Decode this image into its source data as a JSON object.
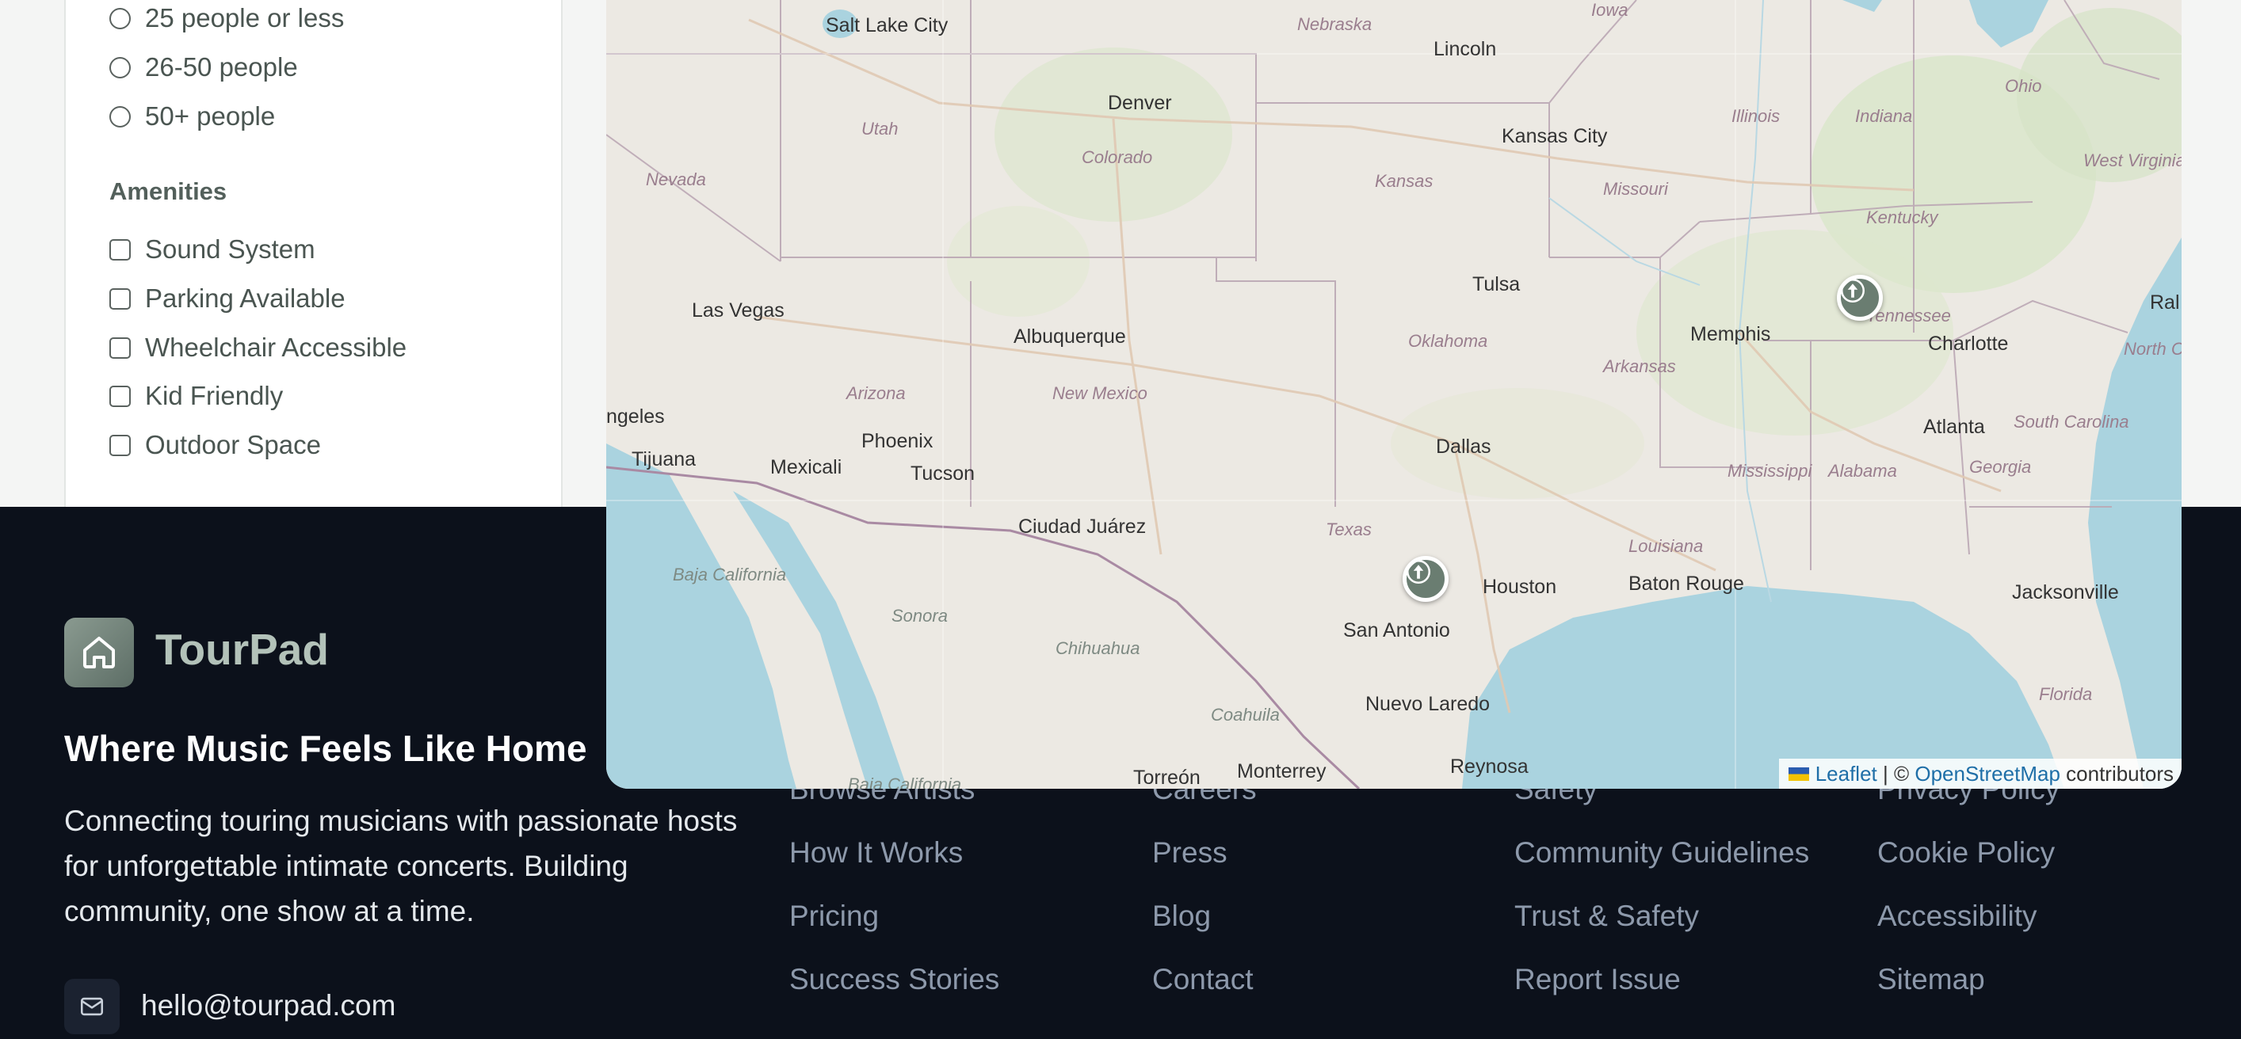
{
  "filters": {
    "capacity_options": [
      "25 people or less",
      "26-50 people",
      "50+ people"
    ],
    "amenities_title": "Amenities",
    "amenities": [
      "Sound System",
      "Parking Available",
      "Wheelchair Accessible",
      "Kid Friendly",
      "Outdoor Space"
    ]
  },
  "map": {
    "cities": [
      "Salt Lake City",
      "Denver",
      "Lincoln",
      "Kansas City",
      "Las Vegas",
      "Tulsa",
      "Albuquerque",
      "Memphis",
      "Charlotte",
      "Atlanta",
      "Dallas",
      "Phoenix",
      "Tucson",
      "Mexicali",
      "Tijuana",
      "Ciudad Juárez",
      "Houston",
      "San Antonio",
      "Baton Rouge",
      "Jacksonville",
      "Nuevo Laredo",
      "Monterrey",
      "Reynosa",
      "Torreón",
      "ngeles",
      "Ral"
    ],
    "states": [
      "Nebraska",
      "Iowa",
      "Utah",
      "Colorado",
      "Kansas",
      "Missouri",
      "Illinois",
      "Indiana",
      "Ohio",
      "West Virginia",
      "Kentucky",
      "Nevada",
      "Oklahoma",
      "Arkansas",
      "Tennessee",
      "North Ca",
      "Arizona",
      "New Mexico",
      "Mississippi",
      "Alabama",
      "Georgia",
      "South Carolina",
      "Texas",
      "Louisiana",
      "Florida",
      "Baja California",
      "Sonora",
      "Chihuahua",
      "Coahuila",
      "Baja California"
    ],
    "attribution": {
      "leaflet": "Leaflet",
      "separator": " | © ",
      "osm": "OpenStreetMap",
      "contributors": " contributors"
    },
    "marker_icon": "arrow-up-icon"
  },
  "footer": {
    "brand": "TourPad",
    "logo_icon": "house-icon",
    "tagline": "Where Music Feels Like Home",
    "description": "Connecting touring musicians with passionate hosts for unforgettable intimate concerts. Building community, one show at a time.",
    "email": "hello@tourpad.com",
    "email_icon": "mail-icon",
    "columns": [
      {
        "links": [
          "Browse Artists",
          "How It Works",
          "Pricing",
          "Success Stories"
        ]
      },
      {
        "links": [
          "Careers",
          "Press",
          "Blog",
          "Contact"
        ]
      },
      {
        "links": [
          "Safety",
          "Community Guidelines",
          "Trust & Safety",
          "Report Issue"
        ]
      },
      {
        "links": [
          "Privacy Policy",
          "Cookie Policy",
          "Accessibility",
          "Sitemap"
        ]
      }
    ]
  },
  "colors": {
    "footer_bg": "#0c111b",
    "brand_text": "#b3c2b9",
    "marker": "#6a7d71",
    "water": "#aad3df"
  }
}
